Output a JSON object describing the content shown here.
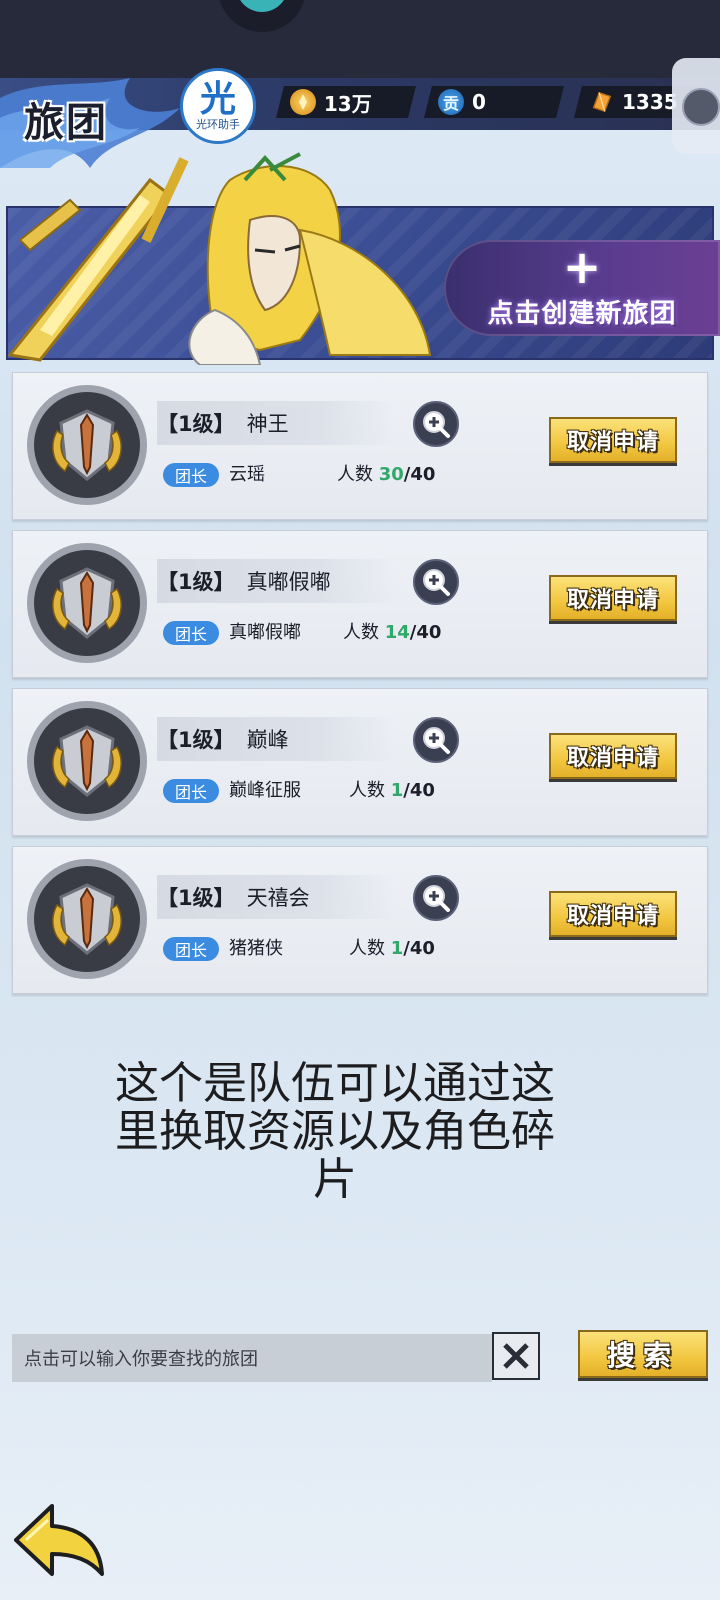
{
  "header": {
    "title": "旅团",
    "helper_glyph": "光",
    "helper_label": "光环助手"
  },
  "resources": {
    "gold": "13万",
    "contrib_icon": "贡",
    "contrib": "0",
    "gems": "1335"
  },
  "banner": {
    "create_label": "点击创建新旅团"
  },
  "guilds": [
    {
      "level": "【1级】",
      "name": "神王",
      "leader_tag": "团长",
      "leader": "云瑶",
      "members_label": "人数",
      "count": "30",
      "max": "/40",
      "action": "取消申请"
    },
    {
      "level": "【1级】",
      "name": "真嘟假嘟",
      "leader_tag": "团长",
      "leader": "真嘟假嘟",
      "members_label": "人数",
      "count": "14",
      "max": "/40",
      "action": "取消申请"
    },
    {
      "level": "【1级】",
      "name": "巅峰",
      "leader_tag": "团长",
      "leader": "巅峰征服",
      "members_label": "人数",
      "count": "1",
      "max": "/40",
      "action": "取消申请"
    },
    {
      "level": "【1级】",
      "name": "天禧会",
      "leader_tag": "团长",
      "leader": "猪猪侠",
      "members_label": "人数",
      "count": "1",
      "max": "/40",
      "action": "取消申请"
    }
  ],
  "caption": "这个是队伍可以通过这里换取资源以及角色碎片",
  "search": {
    "placeholder": "点击可以输入你要查找的旅团",
    "button": "搜索"
  },
  "colors": {
    "member_count": "#2fa86a",
    "leader_tag": "#3b8ce0",
    "button_gold": "#f2c640"
  }
}
